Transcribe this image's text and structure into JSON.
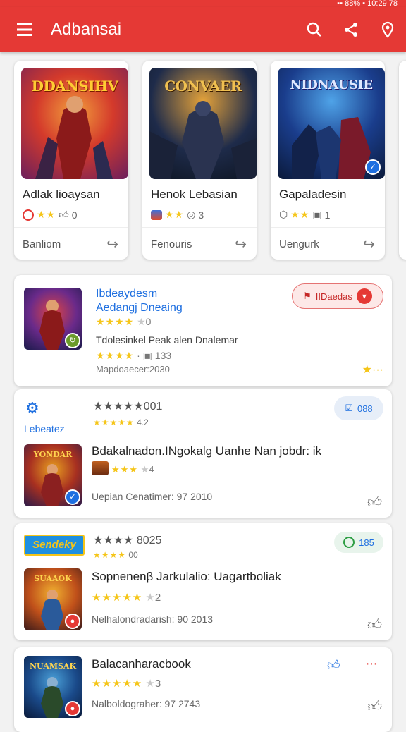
{
  "status": {
    "text": "▪▪ 88% ▪ 10:29 78"
  },
  "appbar": {
    "title": "Adbansai"
  },
  "carousel": [
    {
      "art_text": "DDANSIHV",
      "title": "Adlak lioaysan",
      "count": "0",
      "footer": "Banliom",
      "colors": [
        "#d43a2b",
        "#f2a03d",
        "#6b1f5c"
      ]
    },
    {
      "art_text": "CONVAER",
      "title": "Henok Lebasian",
      "count": "3",
      "footer": "Fenouris",
      "colors": [
        "#1e2b4a",
        "#e4a23a",
        "#0d1420"
      ]
    },
    {
      "art_text": "NIDNAUSIE",
      "title": "Gapaladesin",
      "count": "1",
      "footer": "Uengurk",
      "colors": [
        "#1a3d8c",
        "#4fa3e8",
        "#0b1a3a"
      ]
    }
  ],
  "list": [
    {
      "title_line1": "Ibdeaydesm",
      "title_line2": "Aedangj Dneaing",
      "rating_count": "0",
      "desc": "Tdolesinkel Peak alen Dnalemar",
      "desc_count": "133",
      "date": "Mapdoaecer:2030",
      "pill_label": "IIDaedas"
    },
    {
      "stars_text": "★★★★★001",
      "stars_sub": "4.2",
      "side_label": "Lebeatez",
      "pill_label": "088",
      "title": "Bdakalnadon.INgokalg Uanhe Nan jobdr: ik",
      "rating_count": "4",
      "date": "Uepian Cenatimer: 97 2010"
    },
    {
      "logo_text": "Sendeky",
      "stars_text": "★★★★ 8025",
      "stars_sub": "00",
      "pill_label": "185",
      "title": "Sopnenenβ Jarkulalio: Uagartboliak",
      "rating_count": "2",
      "date": "Nelhalondradarish: 90 2013",
      "thumb_text": "SUAAOK"
    },
    {
      "title": "Balacanharacbook",
      "rating_count": "3",
      "date": "Nalboldograher: 97 2743",
      "thumb_text": "NUAMSAK"
    }
  ]
}
